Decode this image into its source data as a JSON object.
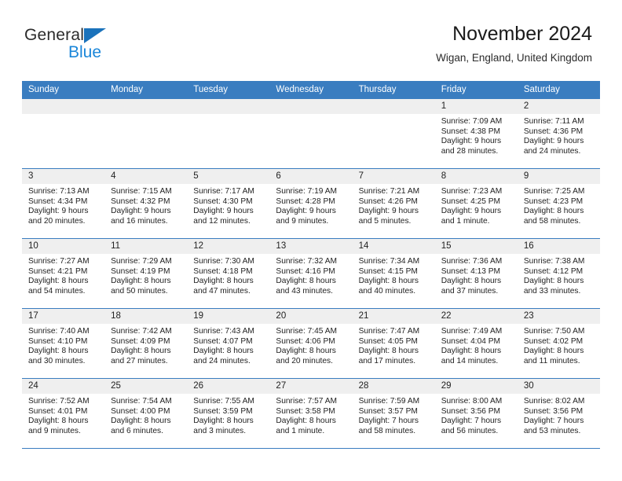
{
  "brand": {
    "name_dark": "General",
    "name_light": "Blue",
    "triangle_color": "#1a72bb",
    "light_color": "#1a86d9"
  },
  "header": {
    "month_title": "November 2024",
    "location": "Wigan, England, United Kingdom"
  },
  "colors": {
    "header_blue": "#3a7dc0",
    "day_band_gray": "#efefef",
    "text": "#1f1f1f"
  },
  "weekdays": [
    "Sunday",
    "Monday",
    "Tuesday",
    "Wednesday",
    "Thursday",
    "Friday",
    "Saturday"
  ],
  "labels": {
    "sunrise_prefix": "Sunrise:",
    "sunset_prefix": "Sunset:",
    "daylight_prefix": "Daylight:"
  },
  "weeks": [
    [
      {
        "day": "",
        "sunrise": "",
        "sunset": "",
        "daylight_line1": "",
        "daylight_line2": ""
      },
      {
        "day": "",
        "sunrise": "",
        "sunset": "",
        "daylight_line1": "",
        "daylight_line2": ""
      },
      {
        "day": "",
        "sunrise": "",
        "sunset": "",
        "daylight_line1": "",
        "daylight_line2": ""
      },
      {
        "day": "",
        "sunrise": "",
        "sunset": "",
        "daylight_line1": "",
        "daylight_line2": ""
      },
      {
        "day": "",
        "sunrise": "",
        "sunset": "",
        "daylight_line1": "",
        "daylight_line2": ""
      },
      {
        "day": "1",
        "sunrise": "Sunrise: 7:09 AM",
        "sunset": "Sunset: 4:38 PM",
        "daylight_line1": "Daylight: 9 hours",
        "daylight_line2": "and 28 minutes."
      },
      {
        "day": "2",
        "sunrise": "Sunrise: 7:11 AM",
        "sunset": "Sunset: 4:36 PM",
        "daylight_line1": "Daylight: 9 hours",
        "daylight_line2": "and 24 minutes."
      }
    ],
    [
      {
        "day": "3",
        "sunrise": "Sunrise: 7:13 AM",
        "sunset": "Sunset: 4:34 PM",
        "daylight_line1": "Daylight: 9 hours",
        "daylight_line2": "and 20 minutes."
      },
      {
        "day": "4",
        "sunrise": "Sunrise: 7:15 AM",
        "sunset": "Sunset: 4:32 PM",
        "daylight_line1": "Daylight: 9 hours",
        "daylight_line2": "and 16 minutes."
      },
      {
        "day": "5",
        "sunrise": "Sunrise: 7:17 AM",
        "sunset": "Sunset: 4:30 PM",
        "daylight_line1": "Daylight: 9 hours",
        "daylight_line2": "and 12 minutes."
      },
      {
        "day": "6",
        "sunrise": "Sunrise: 7:19 AM",
        "sunset": "Sunset: 4:28 PM",
        "daylight_line1": "Daylight: 9 hours",
        "daylight_line2": "and 9 minutes."
      },
      {
        "day": "7",
        "sunrise": "Sunrise: 7:21 AM",
        "sunset": "Sunset: 4:26 PM",
        "daylight_line1": "Daylight: 9 hours",
        "daylight_line2": "and 5 minutes."
      },
      {
        "day": "8",
        "sunrise": "Sunrise: 7:23 AM",
        "sunset": "Sunset: 4:25 PM",
        "daylight_line1": "Daylight: 9 hours",
        "daylight_line2": "and 1 minute."
      },
      {
        "day": "9",
        "sunrise": "Sunrise: 7:25 AM",
        "sunset": "Sunset: 4:23 PM",
        "daylight_line1": "Daylight: 8 hours",
        "daylight_line2": "and 58 minutes."
      }
    ],
    [
      {
        "day": "10",
        "sunrise": "Sunrise: 7:27 AM",
        "sunset": "Sunset: 4:21 PM",
        "daylight_line1": "Daylight: 8 hours",
        "daylight_line2": "and 54 minutes."
      },
      {
        "day": "11",
        "sunrise": "Sunrise: 7:29 AM",
        "sunset": "Sunset: 4:19 PM",
        "daylight_line1": "Daylight: 8 hours",
        "daylight_line2": "and 50 minutes."
      },
      {
        "day": "12",
        "sunrise": "Sunrise: 7:30 AM",
        "sunset": "Sunset: 4:18 PM",
        "daylight_line1": "Daylight: 8 hours",
        "daylight_line2": "and 47 minutes."
      },
      {
        "day": "13",
        "sunrise": "Sunrise: 7:32 AM",
        "sunset": "Sunset: 4:16 PM",
        "daylight_line1": "Daylight: 8 hours",
        "daylight_line2": "and 43 minutes."
      },
      {
        "day": "14",
        "sunrise": "Sunrise: 7:34 AM",
        "sunset": "Sunset: 4:15 PM",
        "daylight_line1": "Daylight: 8 hours",
        "daylight_line2": "and 40 minutes."
      },
      {
        "day": "15",
        "sunrise": "Sunrise: 7:36 AM",
        "sunset": "Sunset: 4:13 PM",
        "daylight_line1": "Daylight: 8 hours",
        "daylight_line2": "and 37 minutes."
      },
      {
        "day": "16",
        "sunrise": "Sunrise: 7:38 AM",
        "sunset": "Sunset: 4:12 PM",
        "daylight_line1": "Daylight: 8 hours",
        "daylight_line2": "and 33 minutes."
      }
    ],
    [
      {
        "day": "17",
        "sunrise": "Sunrise: 7:40 AM",
        "sunset": "Sunset: 4:10 PM",
        "daylight_line1": "Daylight: 8 hours",
        "daylight_line2": "and 30 minutes."
      },
      {
        "day": "18",
        "sunrise": "Sunrise: 7:42 AM",
        "sunset": "Sunset: 4:09 PM",
        "daylight_line1": "Daylight: 8 hours",
        "daylight_line2": "and 27 minutes."
      },
      {
        "day": "19",
        "sunrise": "Sunrise: 7:43 AM",
        "sunset": "Sunset: 4:07 PM",
        "daylight_line1": "Daylight: 8 hours",
        "daylight_line2": "and 24 minutes."
      },
      {
        "day": "20",
        "sunrise": "Sunrise: 7:45 AM",
        "sunset": "Sunset: 4:06 PM",
        "daylight_line1": "Daylight: 8 hours",
        "daylight_line2": "and 20 minutes."
      },
      {
        "day": "21",
        "sunrise": "Sunrise: 7:47 AM",
        "sunset": "Sunset: 4:05 PM",
        "daylight_line1": "Daylight: 8 hours",
        "daylight_line2": "and 17 minutes."
      },
      {
        "day": "22",
        "sunrise": "Sunrise: 7:49 AM",
        "sunset": "Sunset: 4:04 PM",
        "daylight_line1": "Daylight: 8 hours",
        "daylight_line2": "and 14 minutes."
      },
      {
        "day": "23",
        "sunrise": "Sunrise: 7:50 AM",
        "sunset": "Sunset: 4:02 PM",
        "daylight_line1": "Daylight: 8 hours",
        "daylight_line2": "and 11 minutes."
      }
    ],
    [
      {
        "day": "24",
        "sunrise": "Sunrise: 7:52 AM",
        "sunset": "Sunset: 4:01 PM",
        "daylight_line1": "Daylight: 8 hours",
        "daylight_line2": "and 9 minutes."
      },
      {
        "day": "25",
        "sunrise": "Sunrise: 7:54 AM",
        "sunset": "Sunset: 4:00 PM",
        "daylight_line1": "Daylight: 8 hours",
        "daylight_line2": "and 6 minutes."
      },
      {
        "day": "26",
        "sunrise": "Sunrise: 7:55 AM",
        "sunset": "Sunset: 3:59 PM",
        "daylight_line1": "Daylight: 8 hours",
        "daylight_line2": "and 3 minutes."
      },
      {
        "day": "27",
        "sunrise": "Sunrise: 7:57 AM",
        "sunset": "Sunset: 3:58 PM",
        "daylight_line1": "Daylight: 8 hours",
        "daylight_line2": "and 1 minute."
      },
      {
        "day": "28",
        "sunrise": "Sunrise: 7:59 AM",
        "sunset": "Sunset: 3:57 PM",
        "daylight_line1": "Daylight: 7 hours",
        "daylight_line2": "and 58 minutes."
      },
      {
        "day": "29",
        "sunrise": "Sunrise: 8:00 AM",
        "sunset": "Sunset: 3:56 PM",
        "daylight_line1": "Daylight: 7 hours",
        "daylight_line2": "and 56 minutes."
      },
      {
        "day": "30",
        "sunrise": "Sunrise: 8:02 AM",
        "sunset": "Sunset: 3:56 PM",
        "daylight_line1": "Daylight: 7 hours",
        "daylight_line2": "and 53 minutes."
      }
    ]
  ]
}
